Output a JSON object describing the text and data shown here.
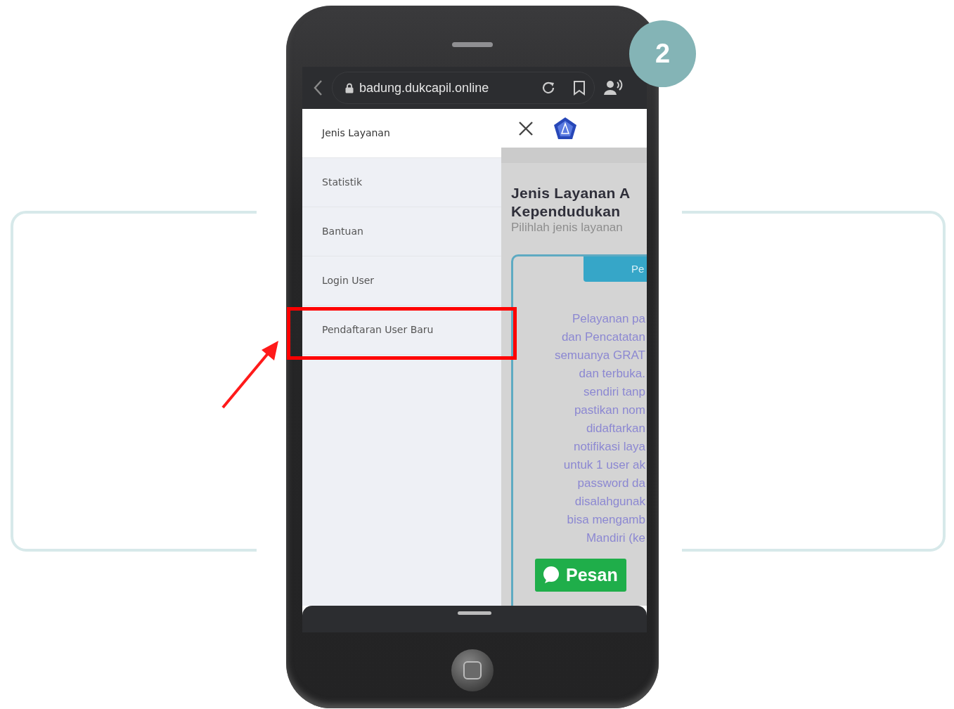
{
  "step_badge": "2",
  "browser": {
    "url": "badung.dukcapil.online"
  },
  "menu": [
    {
      "label": "Jenis Layanan",
      "selected": true,
      "highlighted": false
    },
    {
      "label": "Statistik",
      "selected": false,
      "highlighted": false
    },
    {
      "label": "Bantuan",
      "selected": false,
      "highlighted": false
    },
    {
      "label": "Login User",
      "selected": false,
      "highlighted": false
    },
    {
      "label": "Pendaftaran User Baru",
      "selected": false,
      "highlighted": true
    }
  ],
  "page": {
    "heading": [
      "Jenis Layanan A",
      "Kependudukan"
    ],
    "subtitle": "Pilihlah jenis layanan",
    "tab_label": "Pe",
    "paragraph_lines": [
      "Pelayanan pa",
      "dan Pencatatan",
      "semuanya GRAT",
      "dan terbuka.",
      "sendiri tanp",
      "pastikan nom",
      "didaftarkan",
      "notifikasi laya",
      "untuk 1 user ak",
      "password da",
      "disalahgunak",
      "bisa mengamb",
      "Mandiri (ke"
    ]
  },
  "chat_button": {
    "label": "Pesan"
  }
}
